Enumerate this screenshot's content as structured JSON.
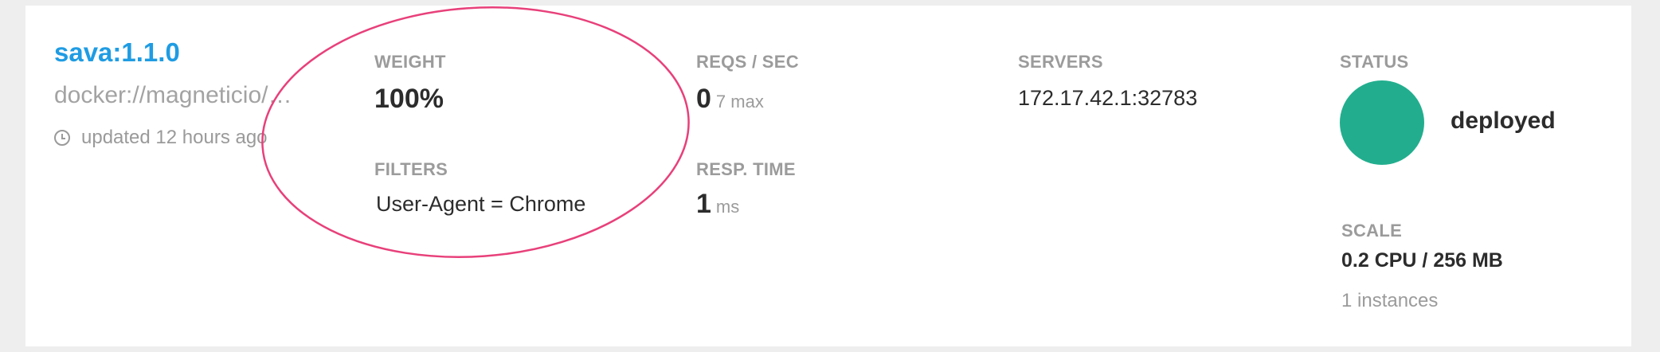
{
  "service": {
    "title": "sava:1.1.0",
    "image": "docker://magneticio/…",
    "updated": "updated 12 hours ago"
  },
  "weight": {
    "label": "WEIGHT",
    "value": "100%"
  },
  "filters": {
    "label": "FILTERS",
    "value": "User-Agent = Chrome"
  },
  "reqs": {
    "label": "REQS / SEC",
    "value": "0",
    "max": "7 max"
  },
  "resp": {
    "label": "RESP. TIME",
    "value": "1",
    "unit": "ms"
  },
  "servers": {
    "label": "SERVERS",
    "items": [
      "172.17.42.1:32783"
    ]
  },
  "status": {
    "label": "STATUS",
    "value": "deployed",
    "color": "#22ae8e"
  },
  "scale": {
    "label": "SCALE",
    "value": "0.2 CPU / 256 MB",
    "instances": "1 instances"
  },
  "annotation": {
    "color": "#e8407a"
  }
}
